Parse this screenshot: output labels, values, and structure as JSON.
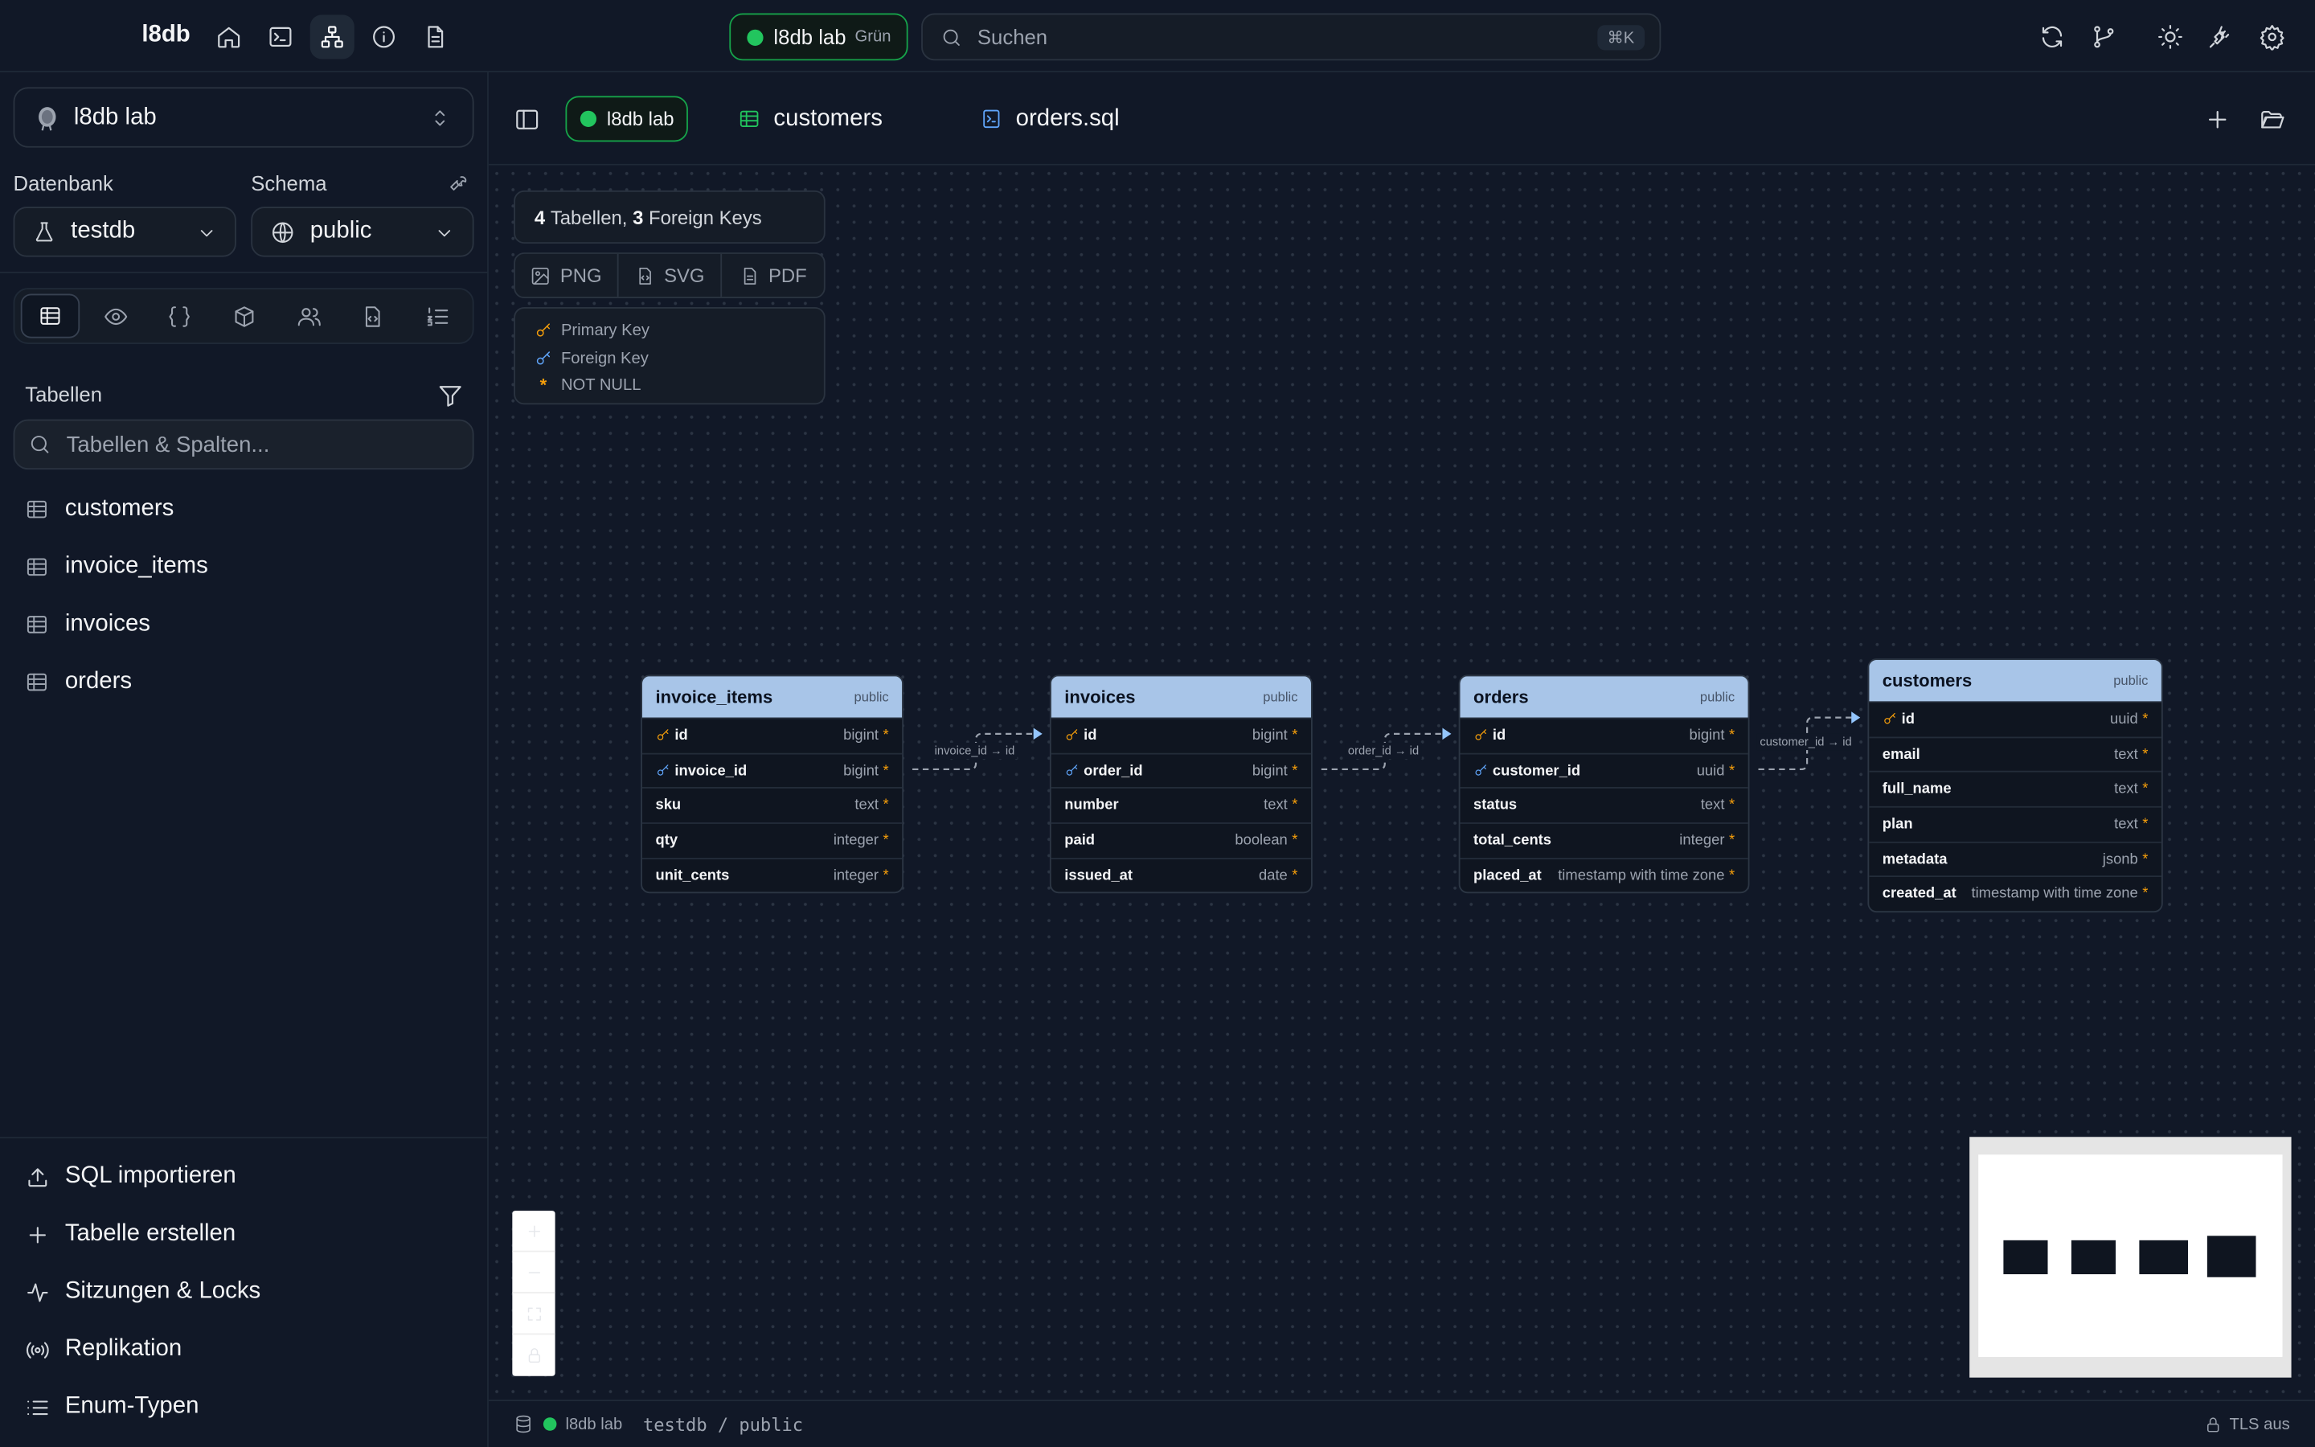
{
  "app": {
    "name": "l8db"
  },
  "connection": {
    "name": "l8db lab",
    "env": "Grün",
    "color": "#22c55e"
  },
  "search": {
    "placeholder": "Suchen",
    "shortcut": "⌘K"
  },
  "sidebar": {
    "connection_name": "l8db lab",
    "database_label": "Datenbank",
    "database_value": "testdb",
    "schema_label": "Schema",
    "schema_value": "public",
    "tables_title": "Tabellen",
    "table_search_placeholder": "Tabellen & Spalten...",
    "tables": [
      "customers",
      "invoice_items",
      "invoices",
      "orders"
    ],
    "bottom_items": [
      "SQL importieren",
      "Tabelle erstellen",
      "Sitzungen & Locks",
      "Replikation",
      "Enum-Typen"
    ]
  },
  "editor_tabs": [
    {
      "label": "l8db lab",
      "icon": "connection-dot"
    },
    {
      "label": "customers",
      "icon": "table-icon"
    },
    {
      "label": "orders.sql",
      "icon": "sql-file-icon"
    }
  ],
  "diagram": {
    "summary": {
      "tables_count": "4",
      "tables_word": "Tabellen,",
      "fk_count": "3",
      "fk_word": "Foreign Keys"
    },
    "export": [
      "PNG",
      "SVG",
      "PDF"
    ],
    "legend": {
      "pk": "Primary Key",
      "fk": "Foreign Key",
      "nn_star": "*",
      "nn": "NOT NULL"
    },
    "tables": [
      {
        "name": "invoice_items",
        "schema": "public",
        "columns": [
          {
            "name": "id",
            "type": "bigint",
            "key": "pk"
          },
          {
            "name": "invoice_id",
            "type": "bigint",
            "key": "fk"
          },
          {
            "name": "sku",
            "type": "text",
            "key": ""
          },
          {
            "name": "qty",
            "type": "integer",
            "key": ""
          },
          {
            "name": "unit_cents",
            "type": "integer",
            "key": ""
          }
        ]
      },
      {
        "name": "invoices",
        "schema": "public",
        "columns": [
          {
            "name": "id",
            "type": "bigint",
            "key": "pk"
          },
          {
            "name": "order_id",
            "type": "bigint",
            "key": "fk"
          },
          {
            "name": "number",
            "type": "text",
            "key": ""
          },
          {
            "name": "paid",
            "type": "boolean",
            "key": ""
          },
          {
            "name": "issued_at",
            "type": "date",
            "key": ""
          }
        ]
      },
      {
        "name": "orders",
        "schema": "public",
        "columns": [
          {
            "name": "id",
            "type": "bigint",
            "key": "pk"
          },
          {
            "name": "customer_id",
            "type": "uuid",
            "key": "fk"
          },
          {
            "name": "status",
            "type": "text",
            "key": ""
          },
          {
            "name": "total_cents",
            "type": "integer",
            "key": ""
          },
          {
            "name": "placed_at",
            "type": "timestamp with time zone",
            "key": ""
          }
        ]
      },
      {
        "name": "customers",
        "schema": "public",
        "columns": [
          {
            "name": "id",
            "type": "uuid",
            "key": "pk"
          },
          {
            "name": "email",
            "type": "text",
            "key": ""
          },
          {
            "name": "full_name",
            "type": "text",
            "key": ""
          },
          {
            "name": "plan",
            "type": "text",
            "key": ""
          },
          {
            "name": "metadata",
            "type": "jsonb",
            "key": ""
          },
          {
            "name": "created_at",
            "type": "timestamp with time zone",
            "key": ""
          }
        ]
      }
    ],
    "edges": [
      "invoice_id → id",
      "order_id → id",
      "customer_id → id"
    ]
  },
  "statusbar": {
    "connection": "l8db lab",
    "path": "testdb / public",
    "tls": "TLS aus"
  },
  "colors": {
    "accent_green": "#22c55e",
    "header_blue": "#a8c5e8",
    "pk": "#f59e0b",
    "fk": "#60a5fa"
  }
}
